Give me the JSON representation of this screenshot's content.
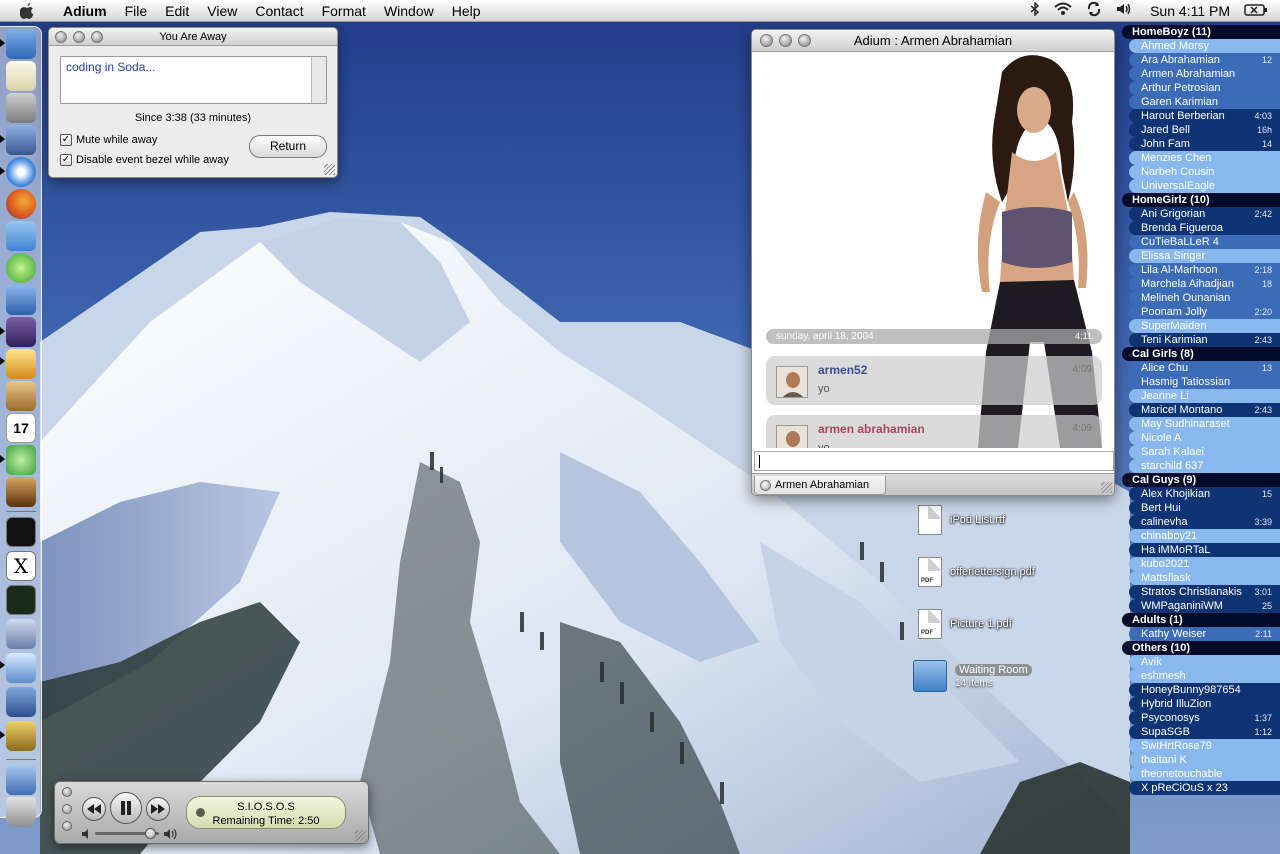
{
  "menubar": {
    "app_name": "Adium",
    "menus": [
      "File",
      "Edit",
      "View",
      "Contact",
      "Format",
      "Window",
      "Help"
    ],
    "clock": "Sun 4:11 PM",
    "status_icons": [
      "bluetooth-icon",
      "wifi-icon",
      "sync-icon",
      "volume-icon",
      "battery-icon"
    ]
  },
  "away_window": {
    "title": "You Are Away",
    "status_message": "coding in Soda...",
    "since": "Since 3:38 (33 minutes)",
    "mute_label": "Mute while away",
    "mute_checked": true,
    "disable_bezel_label": "Disable event bezel while away",
    "disable_bezel_checked": true,
    "return_button": "Return"
  },
  "chat_window": {
    "title": "Adium : Armen Abrahamian",
    "date_header": "sunday, april 18, 2004",
    "date_time": "4:11",
    "messages": [
      {
        "sender": "armen52",
        "time": "4:09",
        "text": "yo",
        "color": "#3b4f8f"
      },
      {
        "sender": "armen abrahamian",
        "time": "4:09",
        "text": "yo",
        "color": "#a9475c"
      }
    ],
    "tab_label": "Armen Abrahamian"
  },
  "buddy_list": {
    "groups": [
      {
        "name": "HomeBoyz (11)",
        "contacts": [
          {
            "name": "Ahmed Morsy",
            "idle": "",
            "state": "online"
          },
          {
            "name": "Ara Abrahamian",
            "idle": "12",
            "state": "idle"
          },
          {
            "name": "Armen Abrahamian",
            "idle": "",
            "state": "idle"
          },
          {
            "name": "Arthur Petrosian",
            "idle": "",
            "state": "idle"
          },
          {
            "name": "Garen Karimian",
            "idle": "",
            "state": "idle"
          },
          {
            "name": "Harout Berberian",
            "idle": "4:03",
            "state": "dark"
          },
          {
            "name": "Jared Bell",
            "idle": "16h",
            "state": "dark"
          },
          {
            "name": "John Fam",
            "idle": "14",
            "state": "dark"
          },
          {
            "name": "Menzies Chen",
            "idle": "",
            "state": "online"
          },
          {
            "name": "Narbeh Cousin",
            "idle": "",
            "state": "online"
          },
          {
            "name": "UniversalEagle",
            "idle": "",
            "state": "online"
          }
        ]
      },
      {
        "name": "HomeGirlz (10)",
        "contacts": [
          {
            "name": "Ani Grigorian",
            "idle": "2:42",
            "state": "dark"
          },
          {
            "name": "Brenda Figueroa",
            "idle": "",
            "state": "dark"
          },
          {
            "name": "CuTieBaLLeR 4",
            "idle": "",
            "state": "idle"
          },
          {
            "name": "Elissa Singer",
            "idle": "",
            "state": "online"
          },
          {
            "name": "Lila Al-Marhoon",
            "idle": "2:18",
            "state": "idle"
          },
          {
            "name": "Marchela Aihadjian",
            "idle": "18",
            "state": "idle"
          },
          {
            "name": "Melineh Ounanian",
            "idle": "",
            "state": "idle"
          },
          {
            "name": "Poonam Jolly",
            "idle": "2:20",
            "state": "idle"
          },
          {
            "name": "SuperMaiden",
            "idle": "",
            "state": "online"
          },
          {
            "name": "Teni Karimian",
            "idle": "2:43",
            "state": "dark"
          }
        ]
      },
      {
        "name": "Cal Girls (8)",
        "contacts": [
          {
            "name": "Alice Chu",
            "idle": "13",
            "state": "idle"
          },
          {
            "name": "Hasmig Tatiossian",
            "idle": "",
            "state": "idle"
          },
          {
            "name": "Jeanne Li",
            "idle": "",
            "state": "online"
          },
          {
            "name": "Maricel Montano",
            "idle": "2:43",
            "state": "dark"
          },
          {
            "name": "May Sudhinaraset",
            "idle": "",
            "state": "online"
          },
          {
            "name": "Nicole A",
            "idle": "",
            "state": "online"
          },
          {
            "name": "Sarah Kalaei",
            "idle": "",
            "state": "online"
          },
          {
            "name": "starchild 637",
            "idle": "",
            "state": "online"
          }
        ]
      },
      {
        "name": "Cal Guys (9)",
        "contacts": [
          {
            "name": "Alex Khojikian",
            "idle": "15",
            "state": "dark"
          },
          {
            "name": "Bert Hui",
            "idle": "",
            "state": "dark"
          },
          {
            "name": "calinevha",
            "idle": "3:39",
            "state": "dark"
          },
          {
            "name": "chinaboy21",
            "idle": "",
            "state": "online"
          },
          {
            "name": "Ha iMMoRTaL",
            "idle": "",
            "state": "dark"
          },
          {
            "name": "kubo2021",
            "idle": "",
            "state": "online"
          },
          {
            "name": "Mattsflask",
            "idle": "",
            "state": "online"
          },
          {
            "name": "Stratos Christianakis",
            "idle": "3:01",
            "state": "dark"
          },
          {
            "name": "WMPaganiniWM",
            "idle": "25",
            "state": "dark"
          }
        ]
      },
      {
        "name": "Adults (1)",
        "contacts": [
          {
            "name": "Kathy Weiser",
            "idle": "2:11",
            "state": "idle"
          }
        ]
      },
      {
        "name": "Others (10)",
        "contacts": [
          {
            "name": "Avik",
            "idle": "",
            "state": "online"
          },
          {
            "name": "eshmesh",
            "idle": "",
            "state": "online"
          },
          {
            "name": "HoneyBunny987654",
            "idle": "",
            "state": "dark"
          },
          {
            "name": "Hybrid IlluZion",
            "idle": "",
            "state": "dark"
          },
          {
            "name": "Psyconosys",
            "idle": "1:37",
            "state": "dark"
          },
          {
            "name": "SupaSGB",
            "idle": "1:12",
            "state": "dark"
          },
          {
            "name": "SwtHrtRose79",
            "idle": "",
            "state": "online"
          },
          {
            "name": "thaitani      K",
            "idle": "",
            "state": "online"
          },
          {
            "name": "theonetouchable",
            "idle": "",
            "state": "online"
          },
          {
            "name": "X pReCiOuS x 23",
            "idle": "",
            "state": "dark"
          }
        ]
      }
    ]
  },
  "desktop_icons": [
    {
      "label": "iPod List.rtf",
      "type": "document"
    },
    {
      "label": "offerlettersign.pdf",
      "type": "pdf"
    },
    {
      "label": "Picture 1.pdf",
      "type": "pdf"
    },
    {
      "label": "Waiting Room",
      "sub": "14 items",
      "type": "folder"
    }
  ],
  "pdf_badge": "PDF",
  "itunes": {
    "track": "S.I.O.S.O.S",
    "remaining": "Remaining Time: 2:50"
  },
  "dock": {
    "items": [
      "finder-icon",
      "textedit-icon",
      "calculator-icon",
      "xcode-icon",
      "safari-icon",
      "firefox-icon",
      "ical-icon",
      "dashboard-icon",
      "xcode-hammer-icon",
      "app-icon",
      "adium-icon",
      "address-book-icon",
      "calendar-icon",
      "itunes-icon",
      "iphoto-icon",
      "terminal-icon",
      "x11-icon",
      "activity-monitor-icon",
      "app2-icon",
      "app3-icon",
      "app4-icon",
      "app5-icon",
      "applications-folder-icon",
      "trash-icon"
    ],
    "calendar_day": "17",
    "x11_label": "X"
  }
}
